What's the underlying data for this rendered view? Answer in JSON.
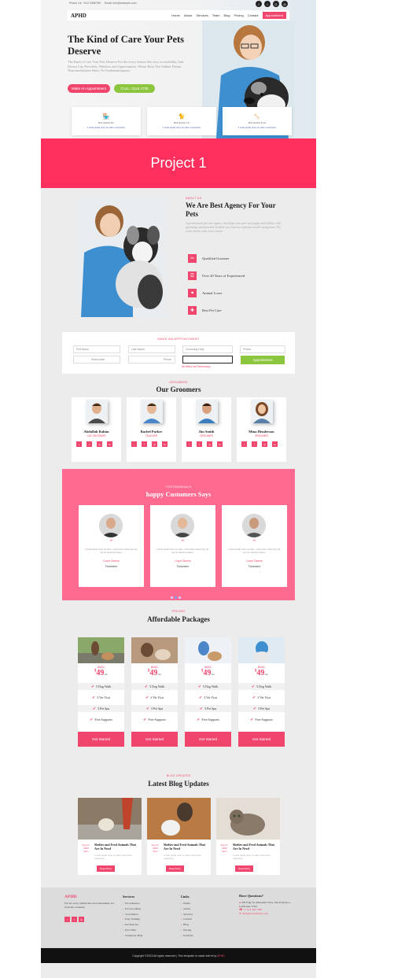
{
  "topbar": {
    "phone": "Phone Us: +012 3456789",
    "email": "Email: info@example.com"
  },
  "nav": {
    "logo": "APHD",
    "items": [
      "Home",
      "About",
      "Services",
      "Team",
      "Blog",
      "Pricing",
      "Contact"
    ],
    "cta": "Appointment"
  },
  "hero": {
    "title": "The Kind of Care Your Pets Deserve",
    "desc": "The Kind of Care Your Pets Deserve For the every feature like easy accessibility, find Dream City Providers, Websites and Opportunities. Please Have The Submit Dream Neuromodulators Hairy Ve Gradoutskeipperty",
    "btn_primary": "Make An Appointment",
    "btn_secondary": "CALL: 0124 4730",
    "features": [
      {
        "icon": "shop-icon",
        "t1": "Best Quality Pet",
        "t2": "Lorem ipsum dolor sit amet consectetur"
      },
      {
        "icon": "cat-icon",
        "t1": "Best Quality Cat",
        "t2": "Lorem ipsum dolor sit amet consectetur"
      },
      {
        "icon": "bone-icon",
        "t1": "Best Quality Food",
        "t2": "Lorem ipsum dolor sit amet consectetur"
      }
    ]
  },
  "banner": {
    "label": "Project 1"
  },
  "about": {
    "eyebrow": "ABOUT US",
    "title": "We Are Best Agency For Your Pets",
    "desc": "A professional pet-care agency that helps your pets stay happy and healthy with grooming, nutrition and medical care from an experienced and caring team. We work closely with every owner.",
    "features": [
      "Qualified Groomer",
      "Over 20 Years of Experienced",
      "Animal Lover",
      "Best Pet Care"
    ]
  },
  "appointment": {
    "title": "MAKE AN APPOINTMENT",
    "fields": [
      "Full Name",
      "Last Name",
      "Grooming Help",
      "Phone",
      "Select date",
      "Phone"
    ],
    "button": "Appointment",
    "note": "All fields are Necessary"
  },
  "groomers": {
    "eyebrow": "GROOMERS",
    "title": "Our Groomers",
    "people": [
      {
        "name": "Abdullah Rahim",
        "role": "CAT GROOMER"
      },
      {
        "name": "Rachel Parker",
        "role": "TEACHER"
      },
      {
        "name": "Jim Smith",
        "role": "GROOMER"
      },
      {
        "name": "Mina Henderson",
        "role": "GROOMER"
      }
    ]
  },
  "testimonials": {
    "eyebrow": "TESTIMONIALS",
    "title": "happy Customers Says",
    "items": [
      {
        "initials": "JK",
        "quote": "Lorem ipsum dolor sit amet, consectetur adipiscing elit, sed do eiusmod tempor.",
        "name": "Lloyd Owens",
        "title": "Customer"
      },
      {
        "initials": "JK",
        "quote": "Lorem ipsum dolor sit amet, consectetur adipiscing elit, sed do eiusmod tempor.",
        "name": "Lloyd Owens",
        "title": "Customer"
      },
      {
        "initials": "JK",
        "quote": "Lorem ipsum dolor sit amet, consectetur adipiscing elit, sed do eiusmod tempor.",
        "name": "Lloyd Owens",
        "title": "Customer"
      }
    ]
  },
  "pricing": {
    "eyebrow": "PRICING",
    "title": "Affordable Packages",
    "plans": [
      {
        "plan": "BASIC",
        "price": "49",
        "currency": "$",
        "period": "/mo",
        "features": [
          "5 Dog Walk",
          "3 Vet Visit",
          "3 Pet Spa",
          "Free Supports"
        ],
        "cta": "Get Started"
      },
      {
        "plan": "BASIC",
        "price": "49",
        "currency": "$",
        "period": "/mo",
        "features": [
          "5 Dog Walk",
          "3 Vet Visit",
          "3 Pet Spa",
          "Free Supports"
        ],
        "cta": "Get Started"
      },
      {
        "plan": "BASIC",
        "price": "49",
        "currency": "$",
        "period": "/mo",
        "features": [
          "5 Dog Walk",
          "3 Vet Visit",
          "3 Pet Spa",
          "Free Supports"
        ],
        "cta": "Get Started"
      },
      {
        "plan": "BASIC",
        "price": "49",
        "currency": "$",
        "period": "/mo",
        "features": [
          "5 Dog Walk",
          "3 Vet Visit",
          "3 Pet Spa",
          "Free Supports"
        ],
        "cta": "Get Started"
      }
    ]
  },
  "blog": {
    "eyebrow": "BLOG UPDATES",
    "title": "Latest Blog Updates",
    "posts": [
      {
        "date": "Aug 17, 2020 Mon",
        "title": "Shelter and Feed Animals That Are In Need",
        "desc": "Lorem ipsum dolor sit amet consectetur adipiscing.",
        "cta": "Read More"
      },
      {
        "date": "Aug 17, 2020 Mon",
        "title": "Shelter and Feed Animals That Are In Need",
        "desc": "Lorem ipsum dolor sit amet consectetur adipiscing.",
        "cta": "Read More"
      },
      {
        "date": "Aug 17, 2020 Mon",
        "title": "Shelter and Feed Animals That Are In Need",
        "desc": "Lorem ipsum dolor sit amet consectetur adipiscing.",
        "cta": "Read More"
      }
    ]
  },
  "footer": {
    "logo": "APHD",
    "about": "Far far away, behind the word mountains, far from the countries.",
    "services_title": "Services",
    "services": [
      "Pet Adoption",
      "Pet Grooming",
      "Vaccination",
      "Dog Training",
      "Pet Daycare",
      "Pet Clinic",
      "Veterinary Help"
    ],
    "links_title": "Links",
    "links": [
      "Home",
      "About",
      "Services",
      "Contact",
      "Blog",
      "Pricing",
      "Portfolio"
    ],
    "contact_title": "Have Questions?",
    "address": "203 Fake St. Mountain View, San Francisco, California, USA",
    "phone": "+1 123 456 7890",
    "email": "info@yourdomain.com"
  },
  "copyright": {
    "text": "Copyright ©2023 All rights reserved | This template is made with ♥ by",
    "brand": "APHD"
  }
}
